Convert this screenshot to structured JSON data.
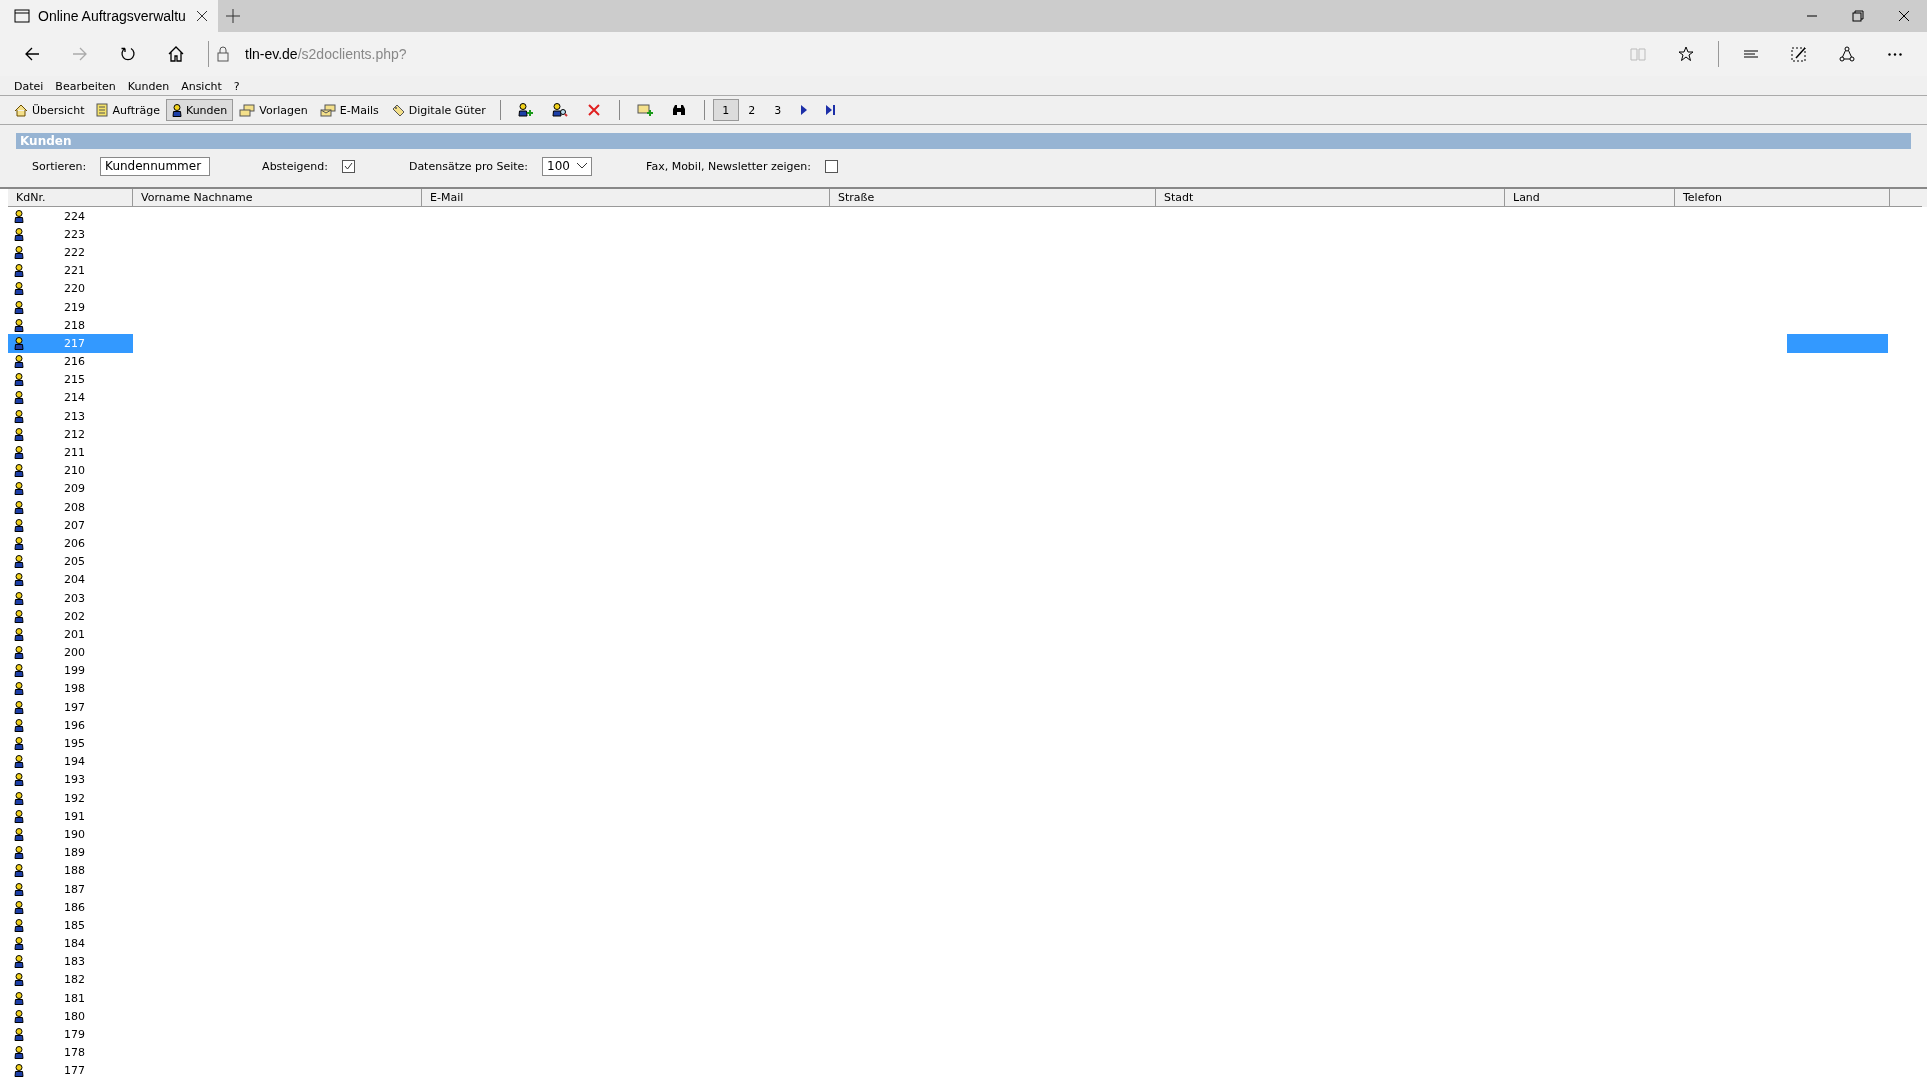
{
  "browser": {
    "tab_title": "Online Auftragsverwaltu",
    "url_host": "tln-ev.de",
    "url_path": "/s2doclients.php?"
  },
  "menu": [
    "Datei",
    "Bearbeiten",
    "Kunden",
    "Ansicht",
    "?"
  ],
  "toolbar": [
    {
      "label": "Übersicht",
      "kind": "home",
      "selected": false
    },
    {
      "label": "Aufträge",
      "kind": "orders",
      "selected": false
    },
    {
      "label": "Kunden",
      "kind": "customers",
      "selected": true
    },
    {
      "label": "Vorlagen",
      "kind": "templates",
      "selected": false
    },
    {
      "label": "E-Mails",
      "kind": "mails",
      "selected": false
    },
    {
      "label": "Digitale Güter",
      "kind": "goods",
      "selected": false
    }
  ],
  "pages": [
    {
      "label": "1",
      "selected": true
    },
    {
      "label": "2",
      "selected": false
    },
    {
      "label": "3",
      "selected": false
    }
  ],
  "panel_title": "Kunden",
  "filters": {
    "sort": {
      "label": "Sortieren:",
      "value": "Kundennummer"
    },
    "descending": {
      "label": "Absteigend:",
      "checked": true
    },
    "per_page": {
      "label": "Datensätze pro Seite:",
      "value": "100"
    },
    "show_extra": {
      "label": "Fax, Mobil, Newsletter zeigen:",
      "checked": false
    }
  },
  "table": {
    "columns": [
      "KdNr.",
      "Vorname Nachname",
      "E-Mail",
      "Straße",
      "Stadt",
      "Land",
      "Telefon"
    ],
    "rows": [
      {
        "id": "224",
        "selected": false
      },
      {
        "id": "223",
        "selected": false
      },
      {
        "id": "222",
        "selected": false
      },
      {
        "id": "221",
        "selected": false
      },
      {
        "id": "220",
        "selected": false
      },
      {
        "id": "219",
        "selected": false
      },
      {
        "id": "218",
        "selected": false
      },
      {
        "id": "217",
        "selected": true
      },
      {
        "id": "216",
        "selected": false
      },
      {
        "id": "215",
        "selected": false
      },
      {
        "id": "214",
        "selected": false
      },
      {
        "id": "213",
        "selected": false
      },
      {
        "id": "212",
        "selected": false
      },
      {
        "id": "211",
        "selected": false
      },
      {
        "id": "210",
        "selected": false
      },
      {
        "id": "209",
        "selected": false
      },
      {
        "id": "208",
        "selected": false
      },
      {
        "id": "207",
        "selected": false
      },
      {
        "id": "206",
        "selected": false
      },
      {
        "id": "205",
        "selected": false
      },
      {
        "id": "204",
        "selected": false
      },
      {
        "id": "203",
        "selected": false
      },
      {
        "id": "202",
        "selected": false
      },
      {
        "id": "201",
        "selected": false
      },
      {
        "id": "200",
        "selected": false
      },
      {
        "id": "199",
        "selected": false
      },
      {
        "id": "198",
        "selected": false
      },
      {
        "id": "197",
        "selected": false
      },
      {
        "id": "196",
        "selected": false
      },
      {
        "id": "195",
        "selected": false
      },
      {
        "id": "194",
        "selected": false
      },
      {
        "id": "193",
        "selected": false
      },
      {
        "id": "192",
        "selected": false
      },
      {
        "id": "191",
        "selected": false
      },
      {
        "id": "190",
        "selected": false
      },
      {
        "id": "189",
        "selected": false
      },
      {
        "id": "188",
        "selected": false
      },
      {
        "id": "187",
        "selected": false
      },
      {
        "id": "186",
        "selected": false
      },
      {
        "id": "185",
        "selected": false
      },
      {
        "id": "184",
        "selected": false
      },
      {
        "id": "183",
        "selected": false
      },
      {
        "id": "182",
        "selected": false
      },
      {
        "id": "181",
        "selected": false
      },
      {
        "id": "180",
        "selected": false
      },
      {
        "id": "179",
        "selected": false
      },
      {
        "id": "178",
        "selected": false
      },
      {
        "id": "177",
        "selected": false
      }
    ]
  }
}
